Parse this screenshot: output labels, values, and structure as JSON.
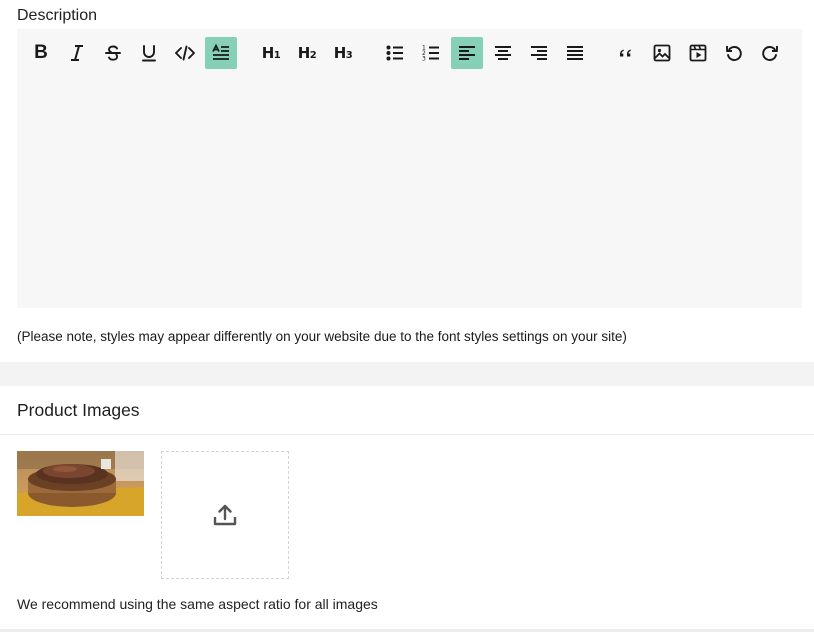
{
  "description": {
    "label": "Description",
    "toolbar": [
      {
        "id": "bold",
        "icon": "bold-icon",
        "label": "B",
        "active": false
      },
      {
        "id": "italic",
        "icon": "italic-icon",
        "active": false
      },
      {
        "id": "strikethrough",
        "icon": "strikethrough-icon",
        "active": false
      },
      {
        "id": "underline",
        "icon": "underline-icon",
        "active": false
      },
      {
        "id": "code",
        "icon": "code-icon",
        "active": false
      },
      {
        "id": "paragraph",
        "icon": "paragraph-format-icon",
        "active": true
      },
      {
        "id": "h1",
        "icon": "heading-1-icon",
        "label": "H",
        "sub": "1",
        "active": false
      },
      {
        "id": "h2",
        "icon": "heading-2-icon",
        "label": "H",
        "sub": "2",
        "active": false
      },
      {
        "id": "h3",
        "icon": "heading-3-icon",
        "label": "H",
        "sub": "3",
        "active": false
      },
      {
        "id": "bullet-list",
        "icon": "bulleted-list-icon",
        "active": false
      },
      {
        "id": "numbered-list",
        "icon": "numbered-list-icon",
        "active": false
      },
      {
        "id": "align-left",
        "icon": "align-left-icon",
        "active": true
      },
      {
        "id": "align-center",
        "icon": "align-center-icon",
        "active": false
      },
      {
        "id": "align-right",
        "icon": "align-right-icon",
        "active": false
      },
      {
        "id": "align-justify",
        "icon": "align-justify-icon",
        "active": false
      },
      {
        "id": "blockquote",
        "icon": "quote-icon",
        "active": false
      },
      {
        "id": "image",
        "icon": "image-icon",
        "active": false
      },
      {
        "id": "video",
        "icon": "video-icon",
        "active": false
      },
      {
        "id": "undo",
        "icon": "undo-icon",
        "active": false
      },
      {
        "id": "redo",
        "icon": "redo-icon",
        "active": false
      }
    ],
    "note": "(Please note, styles may appear differently on your website due to the font styles settings on your site)"
  },
  "product_images": {
    "title": "Product Images",
    "images": [
      {
        "name": "product-image-steak",
        "alt": "steak on wooden board"
      }
    ],
    "upload_icon": "upload-icon",
    "recommendation": "We recommend using the same aspect ratio for all images"
  },
  "colors": {
    "active_button": "#86d0b7",
    "editor_bg": "#f7f7f7",
    "section_gap": "#f3f3f3"
  }
}
